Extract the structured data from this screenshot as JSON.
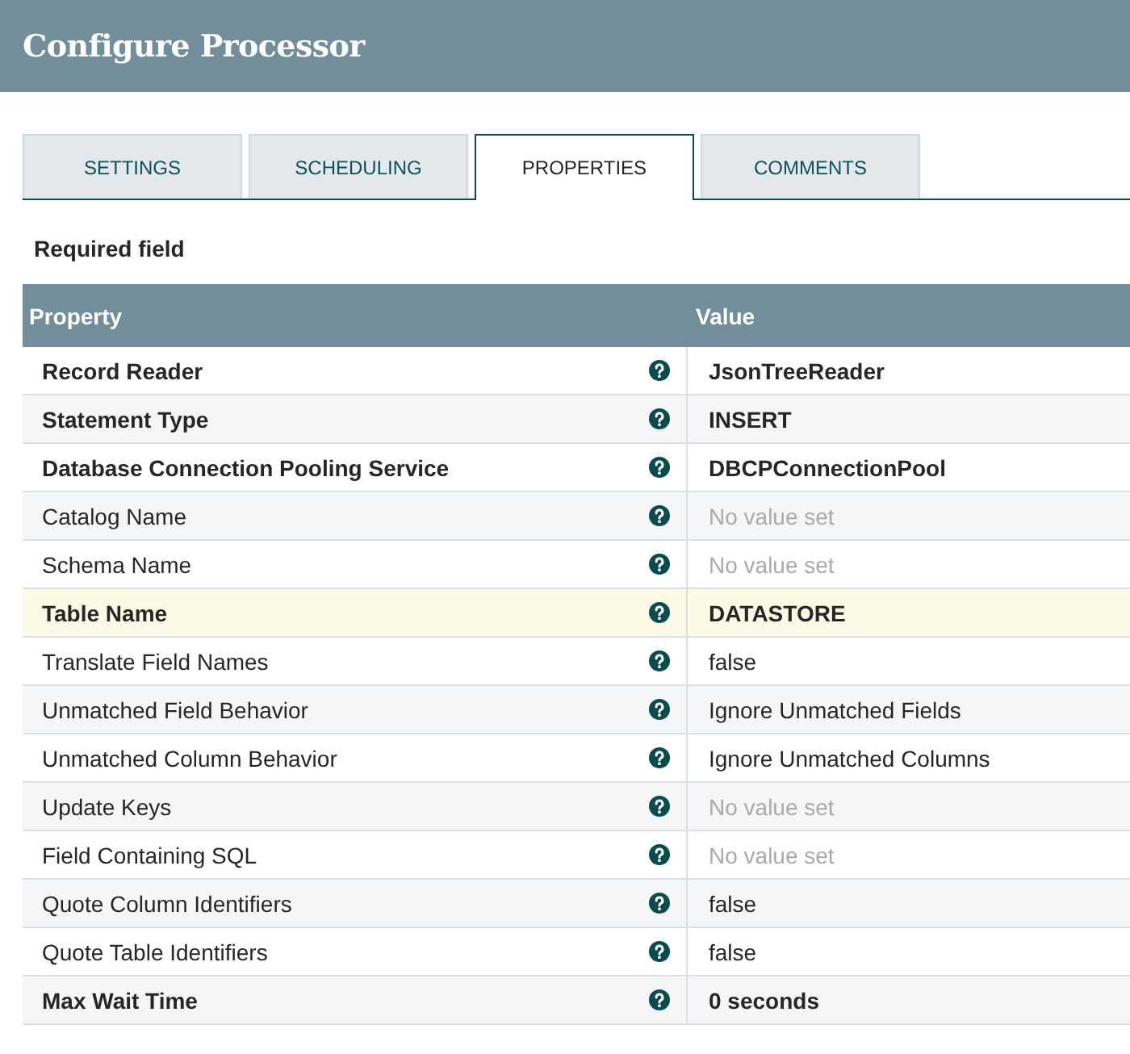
{
  "dialog": {
    "title": "Configure Processor"
  },
  "tabs": [
    {
      "label": "SETTINGS",
      "selected": false
    },
    {
      "label": "SCHEDULING",
      "selected": false
    },
    {
      "label": "PROPERTIES",
      "selected": true
    },
    {
      "label": "COMMENTS",
      "selected": false
    }
  ],
  "required_note": "Required field",
  "table": {
    "columns": [
      "Property",
      "Value"
    ],
    "rows": [
      {
        "property": "Record Reader",
        "value": "JsonTreeReader",
        "required": true,
        "value_set": true,
        "selected": false
      },
      {
        "property": "Statement Type",
        "value": "INSERT",
        "required": true,
        "value_set": true,
        "selected": false
      },
      {
        "property": "Database Connection Pooling Service",
        "value": "DBCPConnectionPool",
        "required": true,
        "value_set": true,
        "selected": false
      },
      {
        "property": "Catalog Name",
        "value": "No value set",
        "required": false,
        "value_set": false,
        "selected": false
      },
      {
        "property": "Schema Name",
        "value": "No value set",
        "required": false,
        "value_set": false,
        "selected": false
      },
      {
        "property": "Table Name",
        "value": "DATASTORE",
        "required": true,
        "value_set": true,
        "selected": true
      },
      {
        "property": "Translate Field Names",
        "value": "false",
        "required": false,
        "value_set": true,
        "selected": false
      },
      {
        "property": "Unmatched Field Behavior",
        "value": "Ignore Unmatched Fields",
        "required": false,
        "value_set": true,
        "selected": false
      },
      {
        "property": "Unmatched Column Behavior",
        "value": "Ignore Unmatched Columns",
        "required": false,
        "value_set": true,
        "selected": false
      },
      {
        "property": "Update Keys",
        "value": "No value set",
        "required": false,
        "value_set": false,
        "selected": false
      },
      {
        "property": "Field Containing SQL",
        "value": "No value set",
        "required": false,
        "value_set": false,
        "selected": false
      },
      {
        "property": "Quote Column Identifiers",
        "value": "false",
        "required": false,
        "value_set": true,
        "selected": false
      },
      {
        "property": "Quote Table Identifiers",
        "value": "false",
        "required": false,
        "value_set": true,
        "selected": false
      },
      {
        "property": "Max Wait Time",
        "value": "0 seconds",
        "required": true,
        "value_set": true,
        "selected": false
      }
    ]
  }
}
